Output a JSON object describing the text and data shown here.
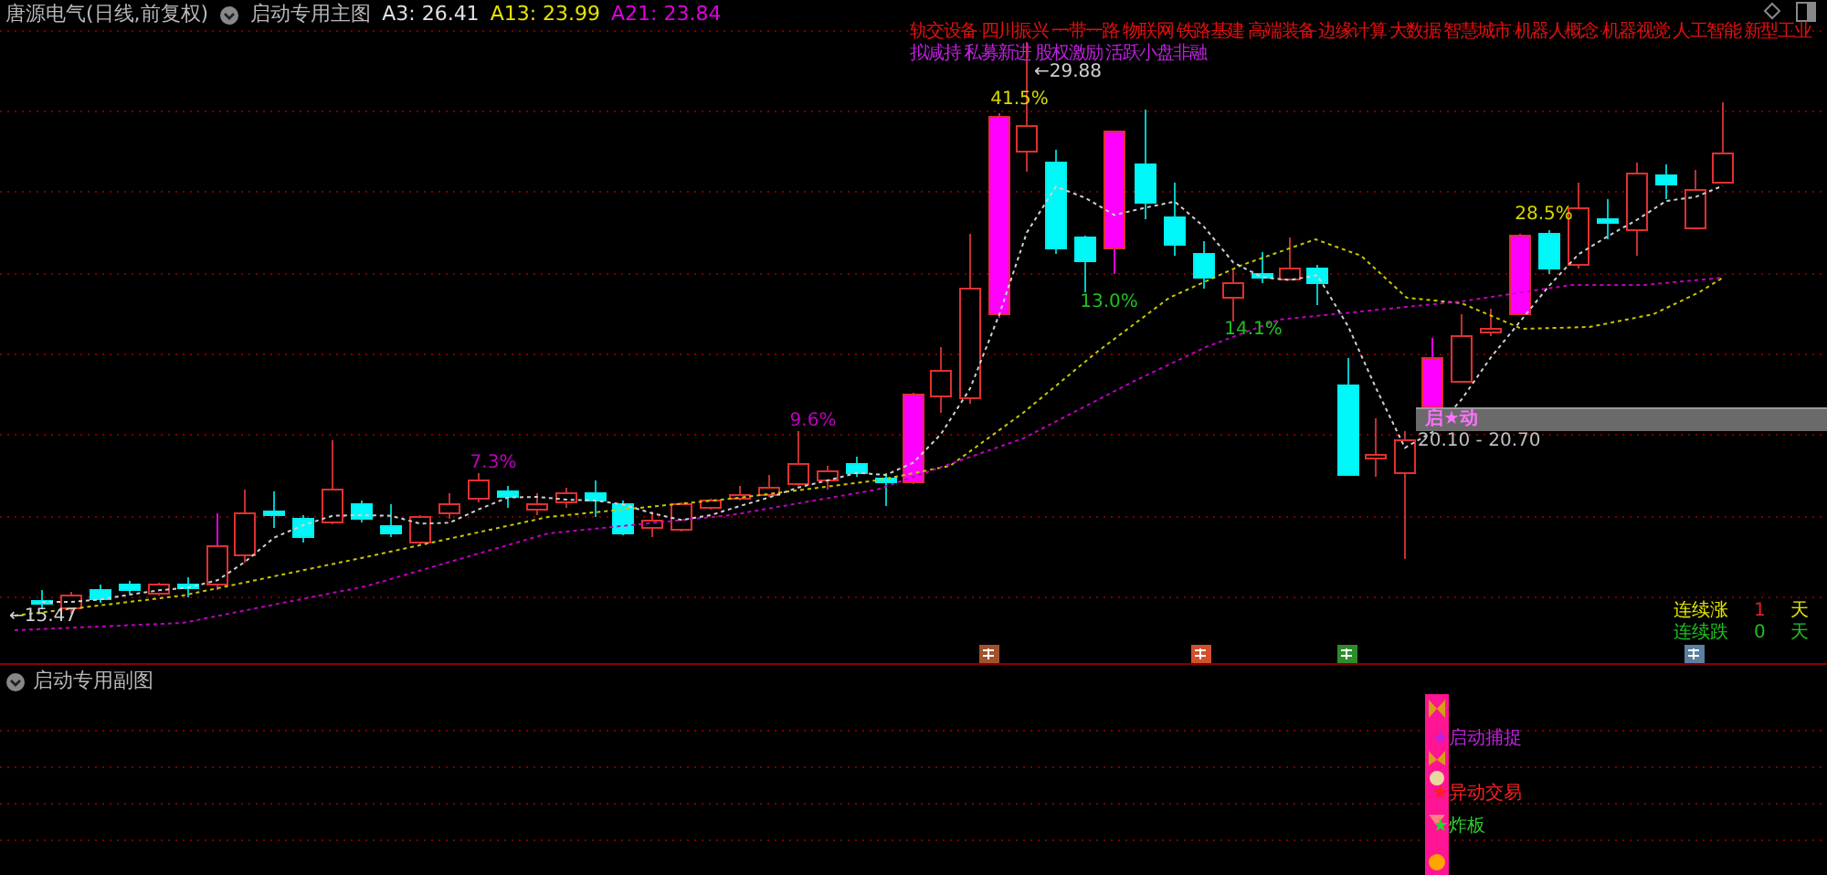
{
  "header": {
    "stock": "唐源电气(日线,前复权)",
    "indicator": "启动专用主图",
    "values": [
      {
        "label": "A3: 26.41",
        "color": "#e0e0e0"
      },
      {
        "label": "A13: 23.99",
        "color": "#e6e600"
      },
      {
        "label": "A21: 23.84",
        "color": "#e000e0"
      }
    ]
  },
  "concept_tags": [
    "轨交设备",
    "四川振兴",
    "一带一路",
    "物联网",
    "铁路基建",
    "高端装备",
    "边缘计算",
    "大数据",
    "智慧城市",
    "机器人概念",
    "机器视觉",
    "人工智能",
    "新型工业"
  ],
  "event_tags": [
    "拟减持",
    "私募新进",
    "股权激励",
    "活跃小盘非融"
  ],
  "price_labels": [
    {
      "text": "←29.88"
    },
    {
      "text": "←15.47"
    }
  ],
  "gain_labels": [
    {
      "text": "7.3%",
      "color": "#c000c0"
    },
    {
      "text": "9.6%",
      "color": "#c000c0"
    },
    {
      "text": "41.5%",
      "color": "#d8d800"
    },
    {
      "text": "13.0%",
      "color": "#20c020"
    },
    {
      "text": "14.1%",
      "color": "#20c020"
    },
    {
      "text": "28.5%",
      "color": "#d8d800"
    }
  ],
  "signal": {
    "text": "启★动",
    "range": "20.10 - 20.70"
  },
  "streaks": [
    {
      "label": "连续涨",
      "count": "1",
      "unit": "天",
      "kind": "up"
    },
    {
      "label": "连续跌",
      "count": "0",
      "unit": "天",
      "kind": "down"
    }
  ],
  "sub_panel": {
    "title": "启动专用副图",
    "signals": [
      {
        "text": "★启动捕捉",
        "color": "#c020e0"
      },
      {
        "text": "★异动交易",
        "color": "#ff2020"
      },
      {
        "text": "★炸板",
        "color": "#30d030"
      }
    ]
  }
}
